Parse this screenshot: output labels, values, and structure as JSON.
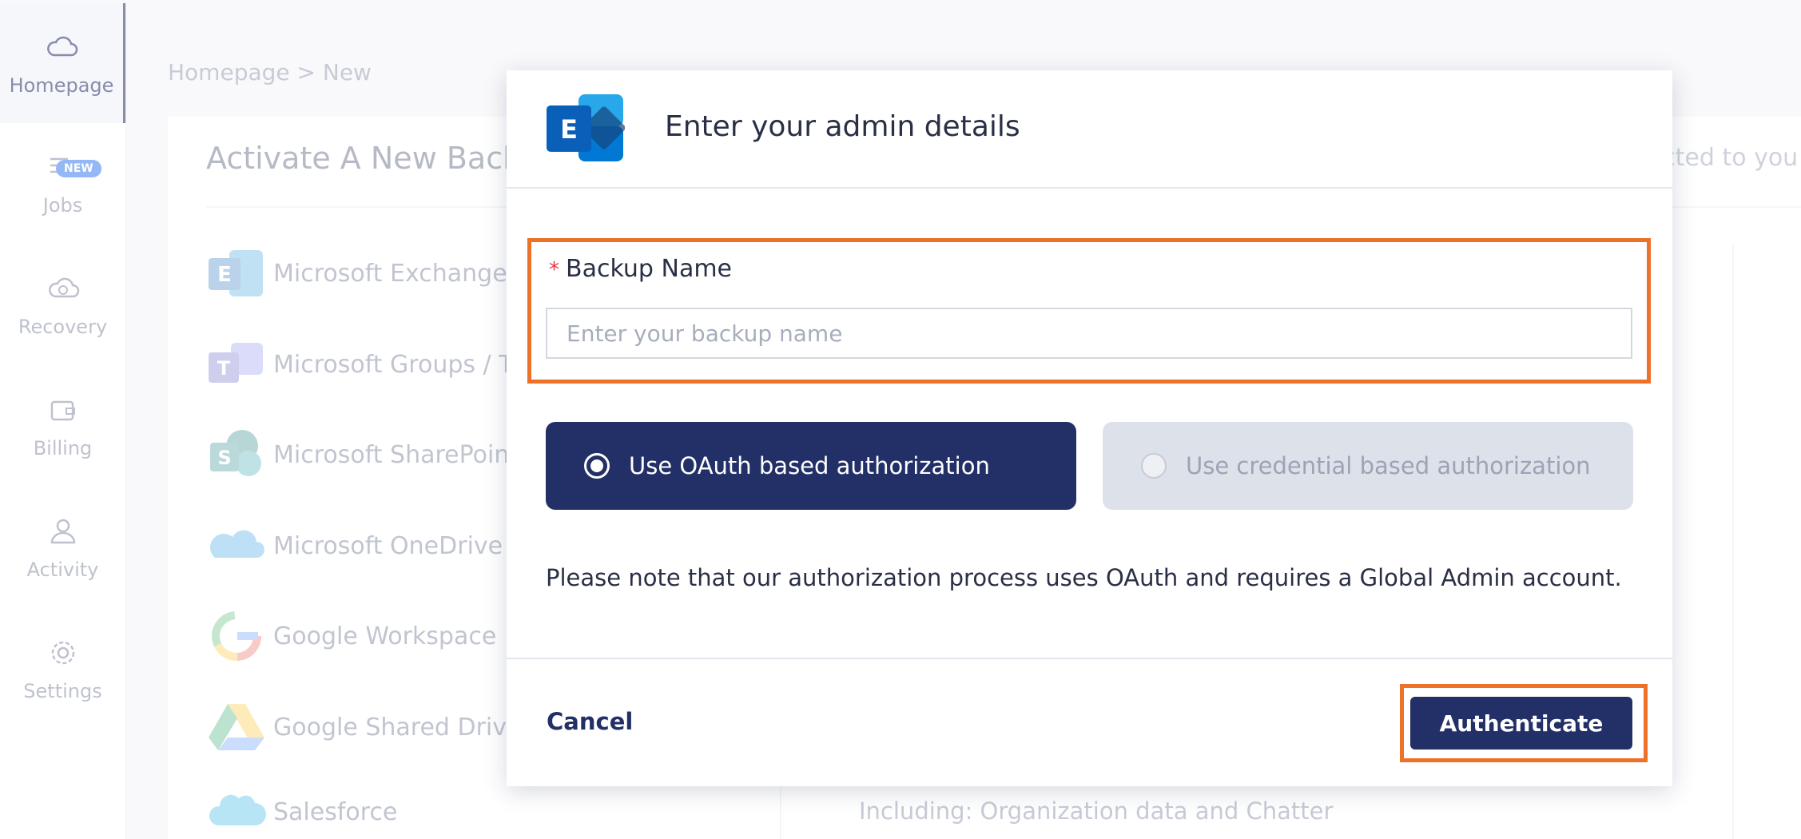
{
  "sidebar": {
    "items": [
      {
        "label": "Homepage",
        "icon": "cloud-icon",
        "active": true
      },
      {
        "label": "Jobs",
        "icon": "list-icon",
        "badge": "NEW"
      },
      {
        "label": "Recovery",
        "icon": "cloud-refresh-icon"
      },
      {
        "label": "Billing",
        "icon": "wallet-icon"
      },
      {
        "label": "Activity",
        "icon": "user-icon"
      },
      {
        "label": "Settings",
        "icon": "gear-icon"
      }
    ]
  },
  "breadcrumb": "Homepage > New",
  "main": {
    "title": "Activate A New Backu",
    "right_text": "rected to you",
    "services": [
      {
        "label": "Microsoft Exchange",
        "icon": "exchange-icon"
      },
      {
        "label": "Microsoft Groups / Te",
        "icon": "teams-icon"
      },
      {
        "label": "Microsoft SharePoint",
        "icon": "sharepoint-icon"
      },
      {
        "label": "Microsoft OneDrive",
        "icon": "onedrive-icon"
      },
      {
        "label": "Google Workspace",
        "icon": "google-icon"
      },
      {
        "label": "Google Shared Drives",
        "icon": "google-drive-icon"
      },
      {
        "label": "Salesforce",
        "icon": "salesforce-icon"
      }
    ],
    "salesforce_desc": "Including: Organization data and Chatter"
  },
  "modal": {
    "title": "Enter your admin details",
    "logo_letter": "E",
    "field": {
      "required_mark": "*",
      "label": "Backup Name",
      "placeholder": "Enter your backup name",
      "value": ""
    },
    "auth_options": [
      {
        "label": "Use OAuth based authorization",
        "selected": true
      },
      {
        "label": "Use credential based authorization",
        "selected": false
      }
    ],
    "note": "Please note that our authorization process uses OAuth and requires a Global Admin account.",
    "cancel_label": "Cancel",
    "authenticate_label": "Authenticate"
  },
  "colors": {
    "primary": "#233067",
    "highlight": "#ee7129",
    "badge": "#3d7cf0"
  }
}
